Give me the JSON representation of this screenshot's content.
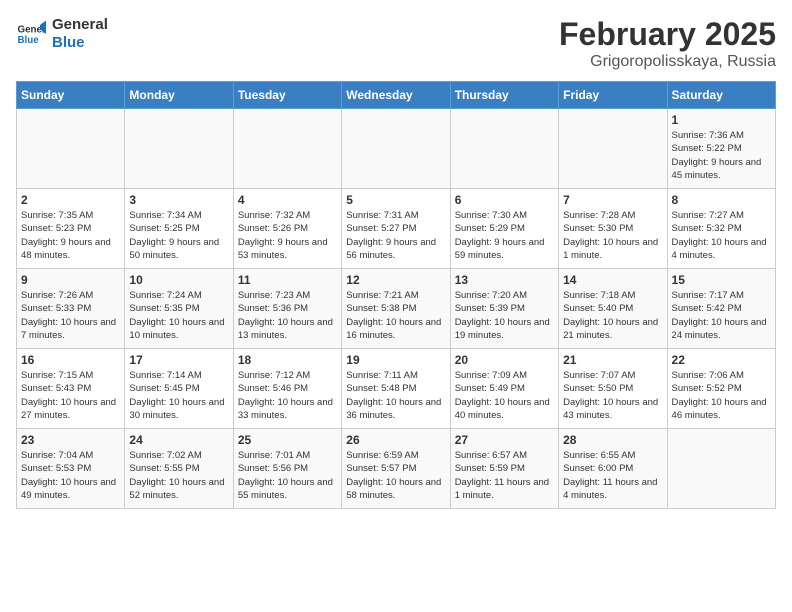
{
  "header": {
    "logo_line1": "General",
    "logo_line2": "Blue",
    "title": "February 2025",
    "subtitle": "Grigoropolisskaya, Russia"
  },
  "weekdays": [
    "Sunday",
    "Monday",
    "Tuesday",
    "Wednesday",
    "Thursday",
    "Friday",
    "Saturday"
  ],
  "weeks": [
    [
      {
        "day": "",
        "info": ""
      },
      {
        "day": "",
        "info": ""
      },
      {
        "day": "",
        "info": ""
      },
      {
        "day": "",
        "info": ""
      },
      {
        "day": "",
        "info": ""
      },
      {
        "day": "",
        "info": ""
      },
      {
        "day": "1",
        "info": "Sunrise: 7:36 AM\nSunset: 5:22 PM\nDaylight: 9 hours and 45 minutes."
      }
    ],
    [
      {
        "day": "2",
        "info": "Sunrise: 7:35 AM\nSunset: 5:23 PM\nDaylight: 9 hours and 48 minutes."
      },
      {
        "day": "3",
        "info": "Sunrise: 7:34 AM\nSunset: 5:25 PM\nDaylight: 9 hours and 50 minutes."
      },
      {
        "day": "4",
        "info": "Sunrise: 7:32 AM\nSunset: 5:26 PM\nDaylight: 9 hours and 53 minutes."
      },
      {
        "day": "5",
        "info": "Sunrise: 7:31 AM\nSunset: 5:27 PM\nDaylight: 9 hours and 56 minutes."
      },
      {
        "day": "6",
        "info": "Sunrise: 7:30 AM\nSunset: 5:29 PM\nDaylight: 9 hours and 59 minutes."
      },
      {
        "day": "7",
        "info": "Sunrise: 7:28 AM\nSunset: 5:30 PM\nDaylight: 10 hours and 1 minute."
      },
      {
        "day": "8",
        "info": "Sunrise: 7:27 AM\nSunset: 5:32 PM\nDaylight: 10 hours and 4 minutes."
      }
    ],
    [
      {
        "day": "9",
        "info": "Sunrise: 7:26 AM\nSunset: 5:33 PM\nDaylight: 10 hours and 7 minutes."
      },
      {
        "day": "10",
        "info": "Sunrise: 7:24 AM\nSunset: 5:35 PM\nDaylight: 10 hours and 10 minutes."
      },
      {
        "day": "11",
        "info": "Sunrise: 7:23 AM\nSunset: 5:36 PM\nDaylight: 10 hours and 13 minutes."
      },
      {
        "day": "12",
        "info": "Sunrise: 7:21 AM\nSunset: 5:38 PM\nDaylight: 10 hours and 16 minutes."
      },
      {
        "day": "13",
        "info": "Sunrise: 7:20 AM\nSunset: 5:39 PM\nDaylight: 10 hours and 19 minutes."
      },
      {
        "day": "14",
        "info": "Sunrise: 7:18 AM\nSunset: 5:40 PM\nDaylight: 10 hours and 21 minutes."
      },
      {
        "day": "15",
        "info": "Sunrise: 7:17 AM\nSunset: 5:42 PM\nDaylight: 10 hours and 24 minutes."
      }
    ],
    [
      {
        "day": "16",
        "info": "Sunrise: 7:15 AM\nSunset: 5:43 PM\nDaylight: 10 hours and 27 minutes."
      },
      {
        "day": "17",
        "info": "Sunrise: 7:14 AM\nSunset: 5:45 PM\nDaylight: 10 hours and 30 minutes."
      },
      {
        "day": "18",
        "info": "Sunrise: 7:12 AM\nSunset: 5:46 PM\nDaylight: 10 hours and 33 minutes."
      },
      {
        "day": "19",
        "info": "Sunrise: 7:11 AM\nSunset: 5:48 PM\nDaylight: 10 hours and 36 minutes."
      },
      {
        "day": "20",
        "info": "Sunrise: 7:09 AM\nSunset: 5:49 PM\nDaylight: 10 hours and 40 minutes."
      },
      {
        "day": "21",
        "info": "Sunrise: 7:07 AM\nSunset: 5:50 PM\nDaylight: 10 hours and 43 minutes."
      },
      {
        "day": "22",
        "info": "Sunrise: 7:06 AM\nSunset: 5:52 PM\nDaylight: 10 hours and 46 minutes."
      }
    ],
    [
      {
        "day": "23",
        "info": "Sunrise: 7:04 AM\nSunset: 5:53 PM\nDaylight: 10 hours and 49 minutes."
      },
      {
        "day": "24",
        "info": "Sunrise: 7:02 AM\nSunset: 5:55 PM\nDaylight: 10 hours and 52 minutes."
      },
      {
        "day": "25",
        "info": "Sunrise: 7:01 AM\nSunset: 5:56 PM\nDaylight: 10 hours and 55 minutes."
      },
      {
        "day": "26",
        "info": "Sunrise: 6:59 AM\nSunset: 5:57 PM\nDaylight: 10 hours and 58 minutes."
      },
      {
        "day": "27",
        "info": "Sunrise: 6:57 AM\nSunset: 5:59 PM\nDaylight: 11 hours and 1 minute."
      },
      {
        "day": "28",
        "info": "Sunrise: 6:55 AM\nSunset: 6:00 PM\nDaylight: 11 hours and 4 minutes."
      },
      {
        "day": "",
        "info": ""
      }
    ]
  ]
}
